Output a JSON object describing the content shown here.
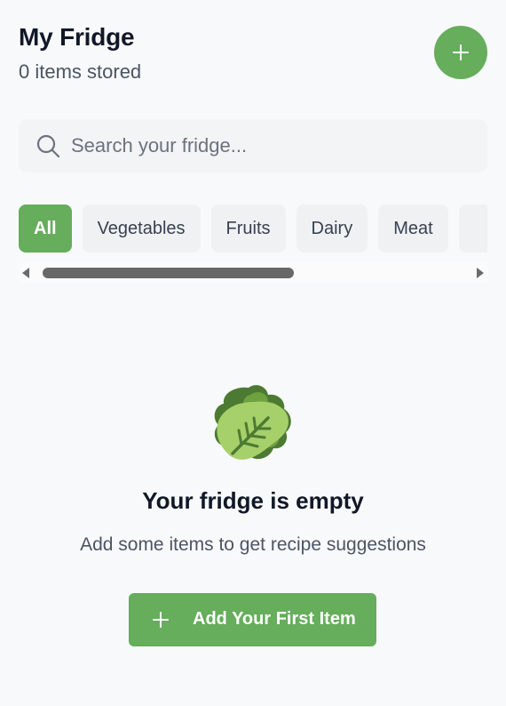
{
  "header": {
    "title": "My Fridge",
    "item_count": "0 items stored",
    "add_icon": "plus-icon"
  },
  "search": {
    "placeholder": "Search your fridge...",
    "value": "",
    "icon": "search-icon"
  },
  "categories": {
    "items": [
      {
        "label": "All",
        "active": true
      },
      {
        "label": "Vegetables",
        "active": false
      },
      {
        "label": "Fruits",
        "active": false
      },
      {
        "label": "Dairy",
        "active": false
      },
      {
        "label": "Meat",
        "active": false
      },
      {
        "label": "",
        "active": false
      }
    ]
  },
  "empty_state": {
    "icon": "leafy-green-icon",
    "title": "Your fridge is empty",
    "message": "Add some items to get recipe suggestions",
    "button_label": "Add Your First Item",
    "button_icon": "plus-icon"
  },
  "colors": {
    "accent": "#66ad5c",
    "background": "#f8f9fb",
    "chip_bg": "#f0f1f3",
    "title_text": "#111827",
    "muted_text": "#4b5563"
  }
}
